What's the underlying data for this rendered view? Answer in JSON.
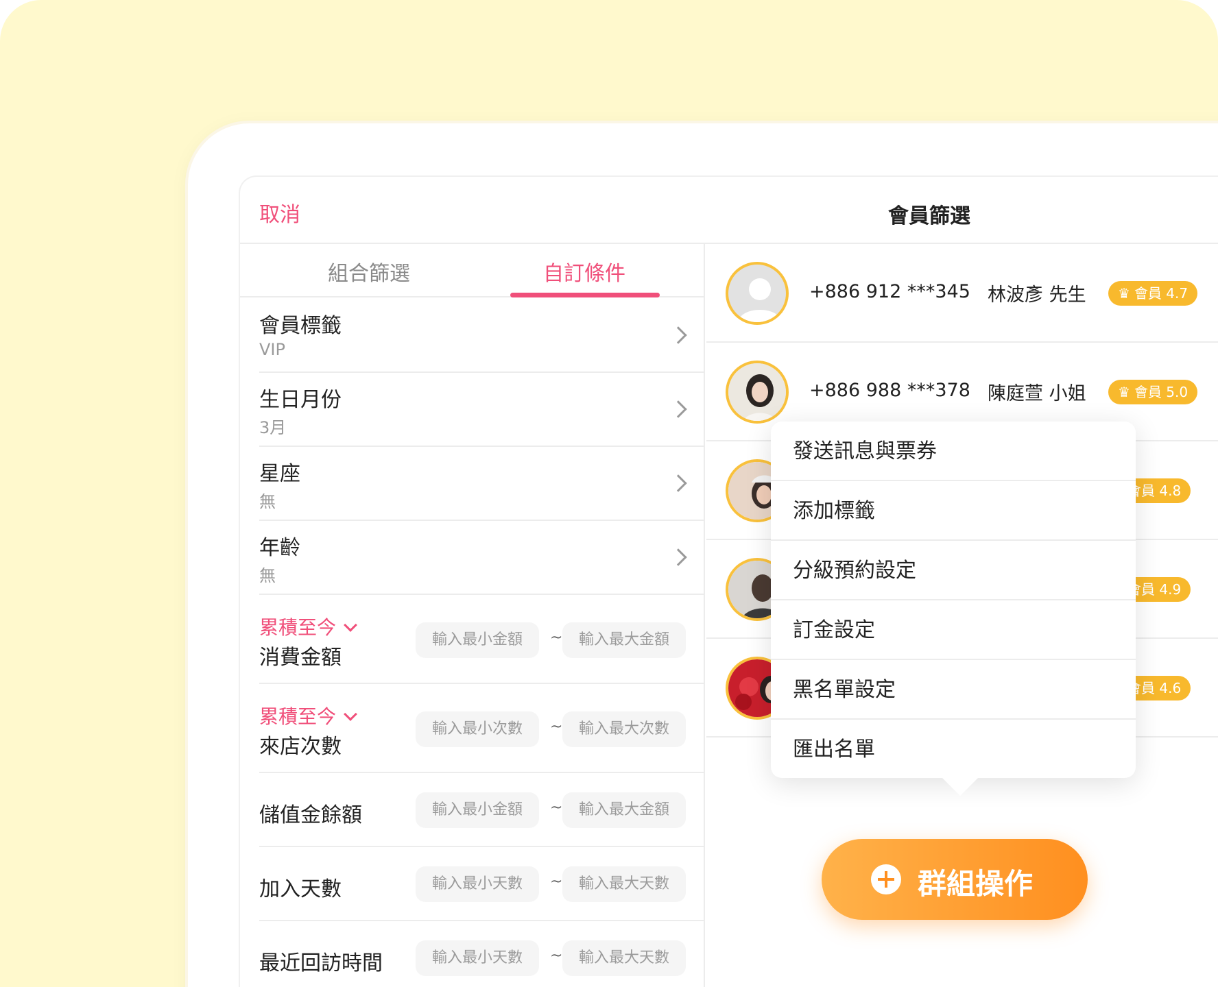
{
  "header": {
    "cancel": "取消",
    "title": "會員篩選"
  },
  "tabs": [
    {
      "label": "組合篩選",
      "active": false
    },
    {
      "label": "自訂條件",
      "active": true
    }
  ],
  "filters": [
    {
      "label": "會員標籤",
      "value": "VIP"
    },
    {
      "label": "生日月份",
      "value": "3月"
    },
    {
      "label": "星座",
      "value": "無"
    },
    {
      "label": "年齡",
      "value": "無"
    }
  ],
  "ranges": [
    {
      "prefix": "累積至今",
      "label": "消費金額",
      "min": "輸入最小金額",
      "max": "輸入最大金額"
    },
    {
      "prefix": "累積至今",
      "label": "來店次數",
      "min": "輸入最小次數",
      "max": "輸入最大次數"
    },
    {
      "label": "儲值金餘額",
      "min": "輸入最小金額",
      "max": "輸入最大金額"
    },
    {
      "label": "加入天數",
      "min": "輸入最小天數",
      "max": "輸入最大天數"
    },
    {
      "label": "最近回訪時間",
      "min": "輸入最小天數",
      "max": "輸入最大天數"
    }
  ],
  "tilde": "~",
  "members": [
    {
      "phone": "+886 912 ***345",
      "name": "林波彥 先生",
      "badge": "會員 4.7"
    },
    {
      "phone": "+886 988 ***378",
      "name": "陳庭萱 小姐",
      "badge": "會員 5.0"
    },
    {
      "badge": "會員 4.8"
    },
    {
      "badge": "會員 4.9"
    },
    {
      "badge": "會員 4.6"
    }
  ],
  "menu": [
    "發送訊息與票券",
    "添加標籤",
    "分級預約設定",
    "訂金設定",
    "黑名單設定",
    "匯出名單"
  ],
  "group_button": "群組操作",
  "colors": {
    "accent": "#f04f7a",
    "badge": "#f8b92d",
    "button": "#ff8f1f",
    "background": "#fff9cd"
  },
  "icons": {
    "crown": "crown-icon",
    "plus": "plus-circle-icon",
    "chevron": "chevron-right-icon"
  }
}
